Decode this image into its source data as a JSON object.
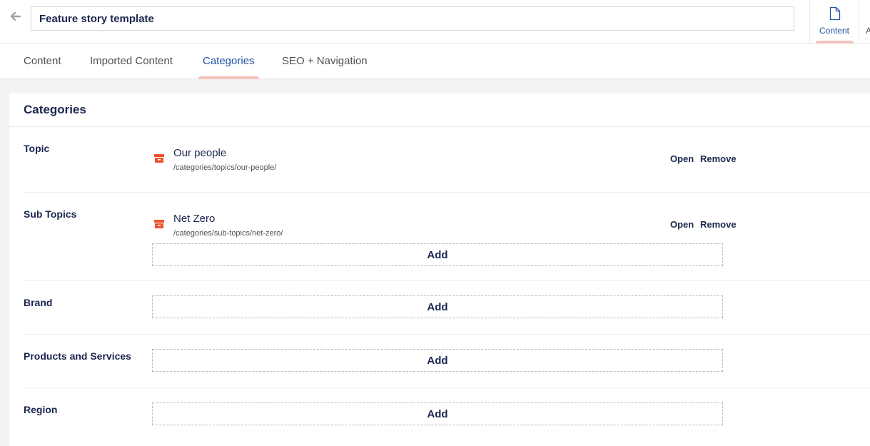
{
  "header": {
    "document_name": "Feature story template",
    "apps": [
      {
        "label": "Content",
        "icon": "document-icon"
      },
      {
        "label": "A"
      }
    ]
  },
  "tabs": [
    {
      "label": "Content"
    },
    {
      "label": "Imported Content"
    },
    {
      "label": "Categories",
      "active": true
    },
    {
      "label": "SEO + Navigation"
    }
  ],
  "panel": {
    "title": "Categories",
    "open_label": "Open",
    "remove_label": "Remove",
    "add_label": "Add",
    "fields": [
      {
        "label": "Topic",
        "items": [
          {
            "name": "Our people",
            "path": "/categories/topics/our-people/"
          }
        ]
      },
      {
        "label": "Sub Topics",
        "items": [
          {
            "name": "Net Zero",
            "path": "/categories/sub-topics/net-zero/"
          }
        ]
      },
      {
        "label": "Brand",
        "items": []
      },
      {
        "label": "Products and Services",
        "items": []
      },
      {
        "label": "Region",
        "items": []
      }
    ]
  },
  "colors": {
    "accent": "#2152a3",
    "text": "#1b264f",
    "indicator": "#f5c1bc",
    "node_icon": "#f0532b"
  }
}
